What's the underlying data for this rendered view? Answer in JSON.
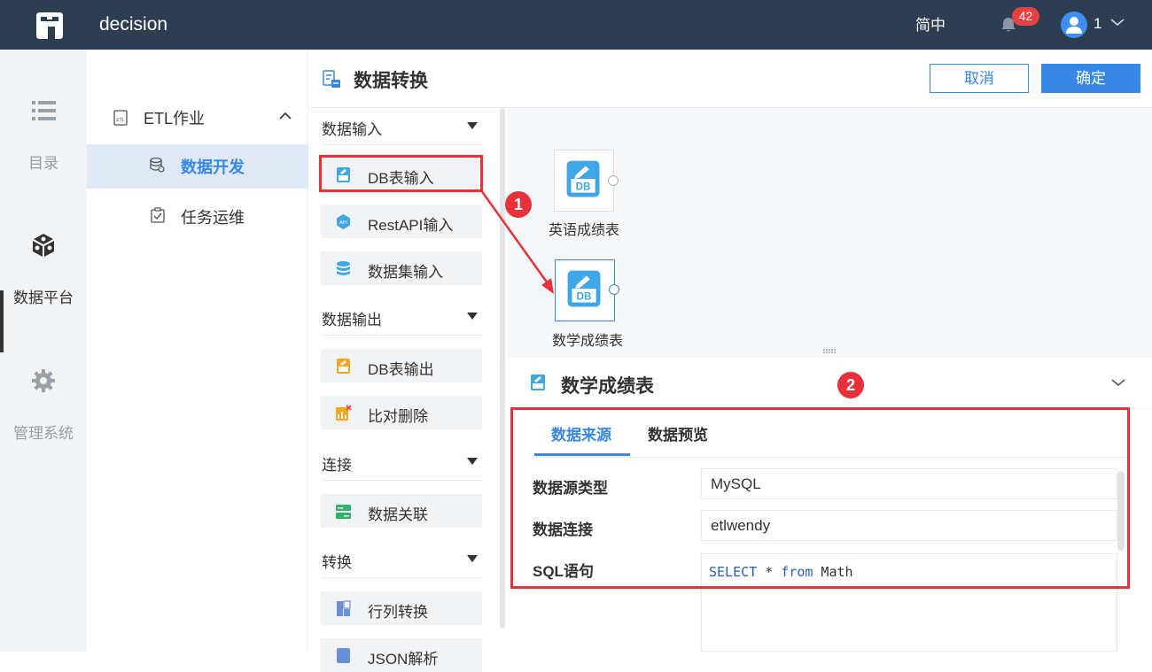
{
  "topbar": {
    "app_title": "decision",
    "lang": "简中",
    "notification_count": "42",
    "user": "1"
  },
  "leftnav": {
    "items": [
      {
        "label": "目录"
      },
      {
        "label": "数据平台"
      },
      {
        "label": "管理系统"
      }
    ]
  },
  "subnav": {
    "group": "ETL作业",
    "items": [
      {
        "label": "数据开发"
      },
      {
        "label": "任务运维"
      }
    ]
  },
  "header": {
    "title": "数据转换",
    "cancel": "取消",
    "confirm": "确定"
  },
  "palette": {
    "cat_input": "数据输入",
    "cat_output": "数据输出",
    "cat_join": "连接",
    "cat_transform": "转换",
    "db_input": "DB表输入",
    "rest_input": "RestAPI输入",
    "dataset_input": "数据集输入",
    "db_output": "DB表输出",
    "compare_delete": "比对删除",
    "data_join": "数据关联",
    "row_col": "行列转换",
    "json_parse": "JSON解析"
  },
  "canvas": {
    "node1": "英语成绩表",
    "node2": "数学成绩表",
    "db_tag": "DB"
  },
  "detail": {
    "title": "数学成绩表",
    "tab_source": "数据来源",
    "tab_preview": "数据预览",
    "field_type_label": "数据源类型",
    "field_type_value": "MySQL",
    "field_conn_label": "数据连接",
    "field_conn_value": "etlwendy",
    "field_sql_label": "SQL语句",
    "sql": {
      "kw1": "SELECT",
      "mid": " * ",
      "kw2": "from",
      "table": " Math"
    }
  },
  "annotations": {
    "m1": "1",
    "m2": "2"
  },
  "colors": {
    "topbar": "#2d3e52",
    "accent": "#3788e6",
    "annotation": "#e8313a"
  }
}
